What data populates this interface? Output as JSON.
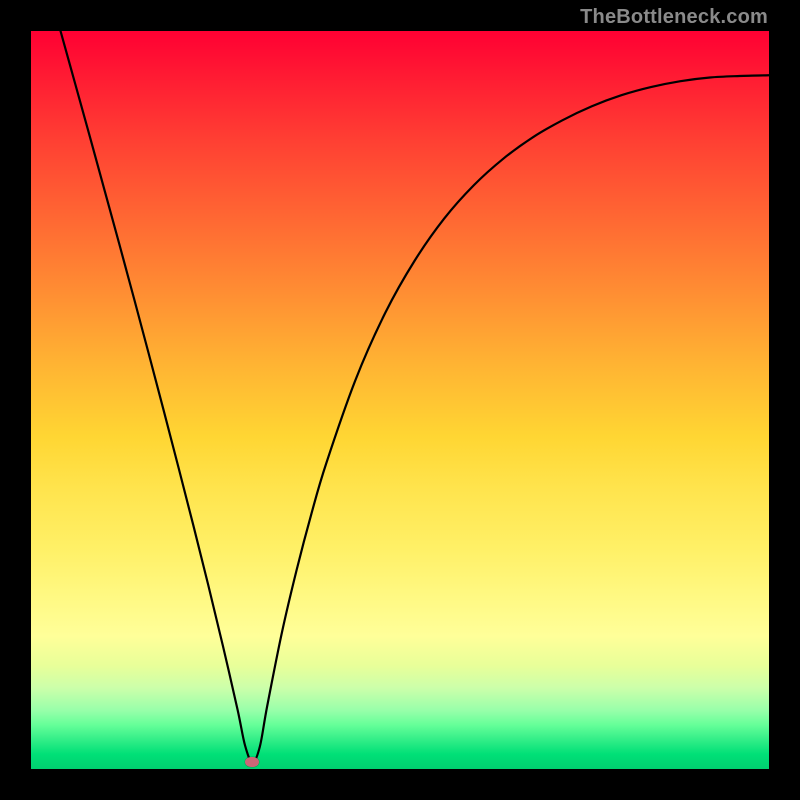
{
  "watermark": "TheBottleneck.com",
  "colors": {
    "curve": "#000000",
    "marker": "#cc6677",
    "frame": "#000000"
  },
  "chart_data": {
    "type": "line",
    "title": "",
    "xlabel": "",
    "ylabel": "",
    "xlim": [
      0,
      100
    ],
    "ylim": [
      0,
      100
    ],
    "series": [
      {
        "name": "bottleneck-curve",
        "x": [
          4,
          6,
          8,
          10,
          12,
          14,
          16,
          18,
          20,
          22,
          24,
          26,
          28,
          29,
          30,
          31,
          32,
          34,
          36,
          38,
          40,
          44,
          48,
          52,
          56,
          60,
          64,
          68,
          72,
          76,
          80,
          84,
          88,
          92,
          96,
          100
        ],
        "y": [
          100,
          92.8,
          85.6,
          78.3,
          71.0,
          63.6,
          56.1,
          48.5,
          40.8,
          33.0,
          25.0,
          16.7,
          8.0,
          3.2,
          0.9,
          3.0,
          8.5,
          18.5,
          27.0,
          34.6,
          41.4,
          52.8,
          61.8,
          68.9,
          74.6,
          79.1,
          82.7,
          85.6,
          87.9,
          89.8,
          91.3,
          92.4,
          93.2,
          93.7,
          93.9,
          94.0
        ]
      }
    ],
    "min_point": {
      "x": 30,
      "y": 0.9
    },
    "background": "vertical-gradient red→orange→yellow→green",
    "grid": false,
    "legend": false
  }
}
